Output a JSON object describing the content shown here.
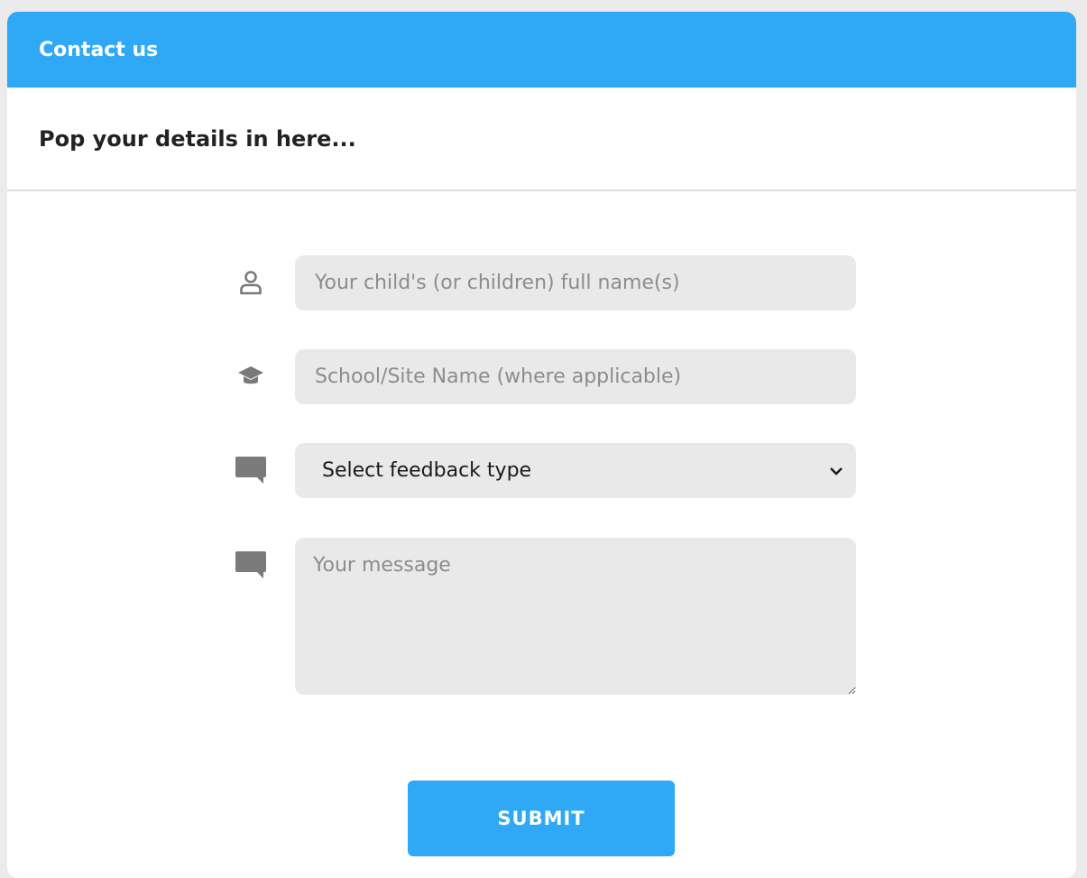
{
  "header": {
    "title": "Contact us"
  },
  "subheader": {
    "title": "Pop your details in here..."
  },
  "form": {
    "child_name": {
      "placeholder": "Your child's (or children) full name(s)",
      "icon": "user-icon"
    },
    "school": {
      "placeholder": "School/Site Name (where applicable)",
      "icon": "graduation-cap-icon"
    },
    "feedback_type": {
      "selected": "Select feedback type",
      "icon": "comment-icon"
    },
    "message": {
      "placeholder": "Your message",
      "icon": "comment-icon"
    },
    "submit_label": "SUBMIT"
  },
  "colors": {
    "accent": "#2fa8f5",
    "field_bg": "#e9e9e9",
    "icon": "#7a7a7a"
  }
}
